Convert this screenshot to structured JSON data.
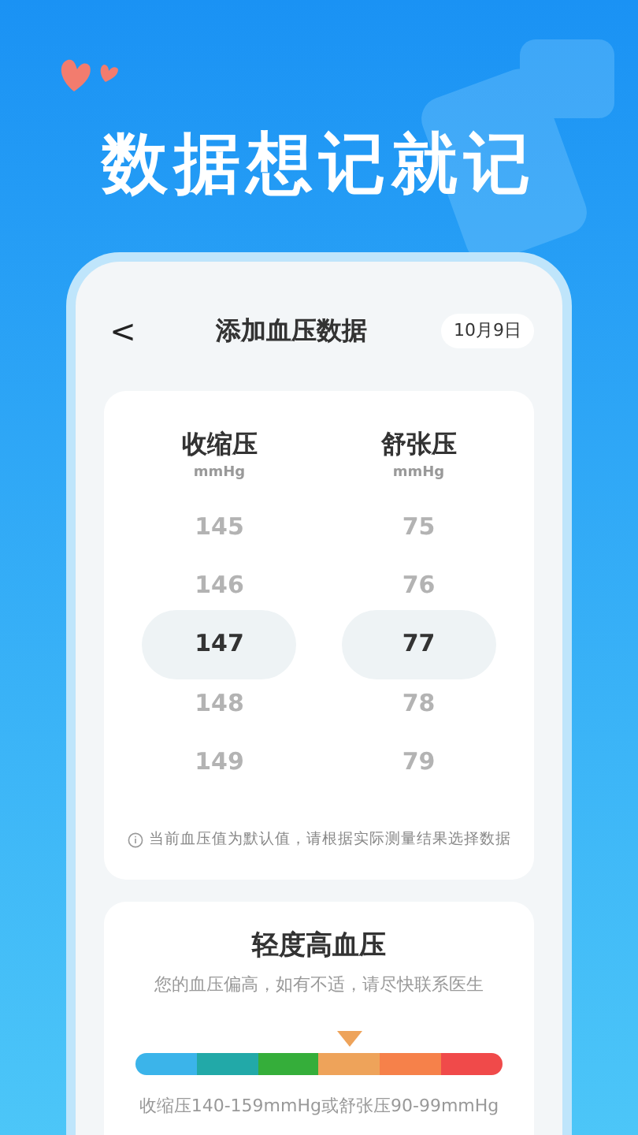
{
  "headline": "数据想记就记",
  "header": {
    "back": "<",
    "title": "添加血压数据",
    "date": "10月9日"
  },
  "pickers": [
    {
      "title": "收缩压",
      "unit": "mmHg",
      "values": [
        {
          "text": "145",
          "selected": false
        },
        {
          "text": "146",
          "selected": false
        },
        {
          "text": "147",
          "selected": true
        },
        {
          "text": "148",
          "selected": false
        },
        {
          "text": "149",
          "selected": false
        }
      ]
    },
    {
      "title": "舒张压",
      "unit": "mmHg",
      "values": [
        {
          "text": "75",
          "selected": false
        },
        {
          "text": "76",
          "selected": false
        },
        {
          "text": "77",
          "selected": true
        },
        {
          "text": "78",
          "selected": false
        },
        {
          "text": "79",
          "selected": false
        }
      ]
    }
  ],
  "note": "当前血压值为默认值，请根据实际测量结果选择数据",
  "result": {
    "title": "轻度高血压",
    "advice": "您的血压偏高，如有不适，请尽快联系医生",
    "scale": [
      {
        "color": "#3bb4ea",
        "selected": false
      },
      {
        "color": "#22a9a8",
        "selected": false
      },
      {
        "color": "#35ae3a",
        "selected": false
      },
      {
        "color": "#eea35a",
        "selected": true
      },
      {
        "color": "#f6814a",
        "selected": false
      },
      {
        "color": "#f04a4a",
        "selected": false
      }
    ],
    "range": "收缩压140-159mmHg或舒张压90-99mmHg"
  }
}
